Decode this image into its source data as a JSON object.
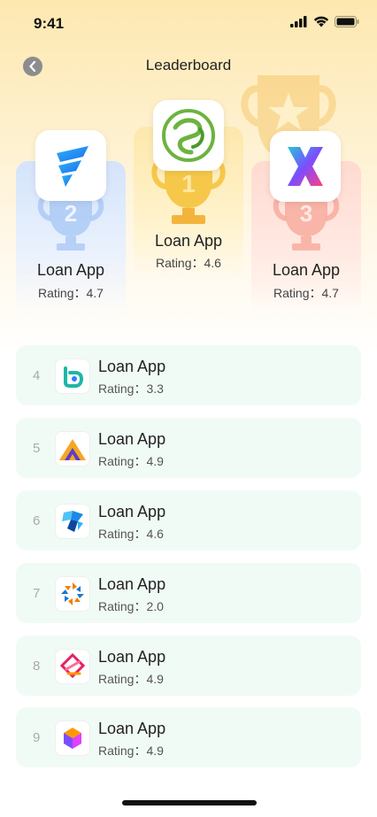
{
  "status": {
    "time": "9:41"
  },
  "nav": {
    "title": "Leaderboard"
  },
  "podium": [
    {
      "rank": "2",
      "name": "Loan App",
      "rating": "Rating：4.7"
    },
    {
      "rank": "1",
      "name": "Loan App",
      "rating": "Rating：4.6"
    },
    {
      "rank": "3",
      "name": "Loan App",
      "rating": "Rating：4.7"
    }
  ],
  "list": [
    {
      "rank": "4",
      "name": "Loan App",
      "rating": "Rating：3.3"
    },
    {
      "rank": "5",
      "name": "Loan App",
      "rating": "Rating：4.9"
    },
    {
      "rank": "6",
      "name": "Loan App",
      "rating": "Rating：4.6"
    },
    {
      "rank": "7",
      "name": "Loan App",
      "rating": "Rating：2.0"
    },
    {
      "rank": "8",
      "name": "Loan App",
      "rating": "Rating：4.9"
    },
    {
      "rank": "9",
      "name": "Loan App",
      "rating": "Rating：4.9"
    }
  ],
  "colors": {
    "header_bg": "#fde8b0",
    "row_bg": "#f1fbf6",
    "gold": "#f6c84a",
    "silver_blue": "#a9c8f5",
    "bronze": "#f7a99a"
  },
  "icons": {
    "back": "chevron-left-icon",
    "signal": "cellular-signal-icon",
    "wifi": "wifi-icon",
    "battery": "battery-icon"
  }
}
